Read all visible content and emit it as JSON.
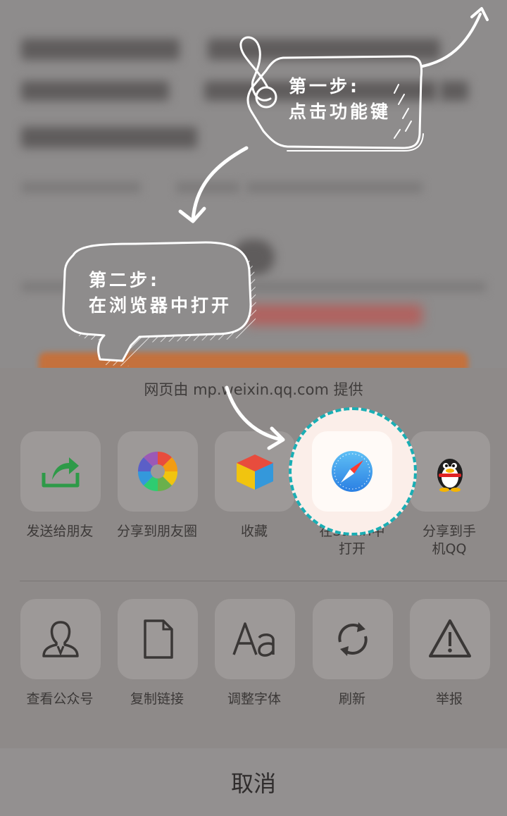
{
  "sheet": {
    "provider_text": "网页由 mp.weixin.qq.com 提供",
    "row1": [
      {
        "label": "发送给朋友",
        "icon": "share-arrow-icon"
      },
      {
        "label": "分享到朋友圈",
        "icon": "moments-aperture-icon"
      },
      {
        "label": "收藏",
        "icon": "favorites-cube-icon"
      },
      {
        "label": "在Safari中打开",
        "icon": "safari-compass-icon"
      },
      {
        "label": "分享到手机QQ",
        "icon": "qq-penguin-icon"
      }
    ],
    "row2": [
      {
        "label": "查看公众号",
        "icon": "person-icon"
      },
      {
        "label": "复制链接",
        "icon": "document-icon"
      },
      {
        "label": "调整字体",
        "icon": "font-aa-icon"
      },
      {
        "label": "刷新",
        "icon": "refresh-icon"
      },
      {
        "label": "举报",
        "icon": "warning-icon"
      }
    ],
    "cancel_label": "取消"
  },
  "callouts": {
    "step1_line1": "第一步:",
    "step1_line2": "点击功能键",
    "step2_line1": "第二步:",
    "step2_line2": "在浏览器中打开"
  },
  "colors": {
    "spotlight_border": "#1aaeb4",
    "safari_blue": "#3a9bef",
    "share_green": "#2e9a48"
  }
}
